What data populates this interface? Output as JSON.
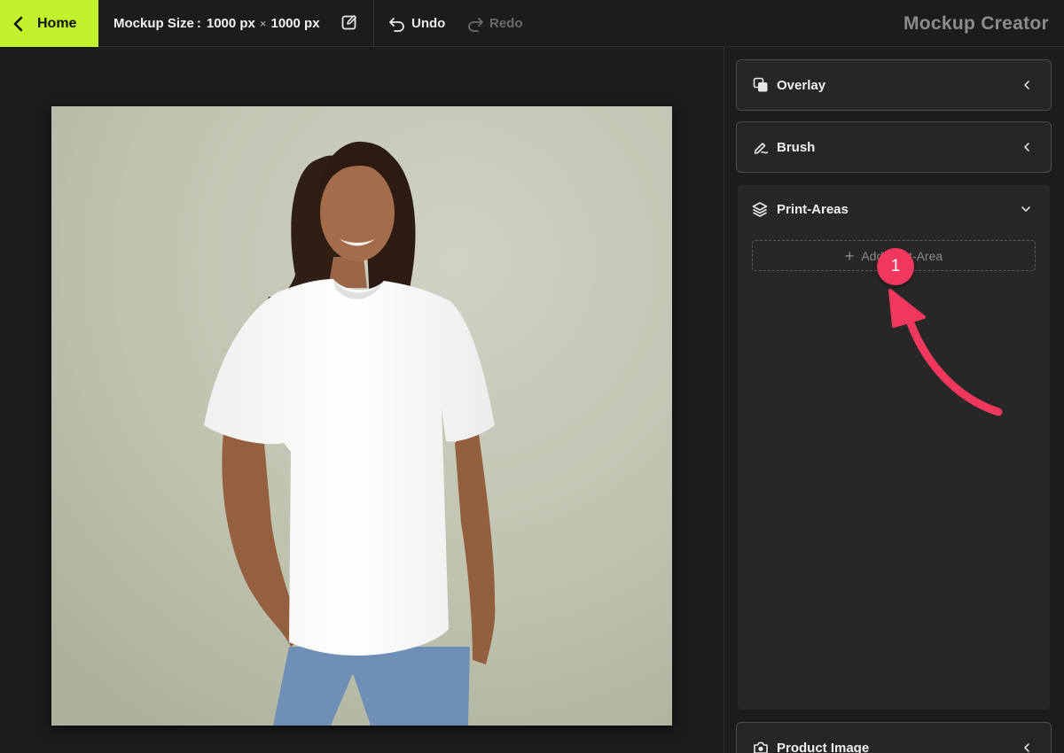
{
  "topbar": {
    "home_label": "Home",
    "mockup_size_label": "Mockup Size",
    "mockup_width": "1000 px",
    "times_sign": "×",
    "mockup_height": "1000 px",
    "undo_label": "Undo",
    "redo_label": "Redo",
    "app_title": "Mockup Creator"
  },
  "panel": {
    "sections": [
      {
        "label": "Overlay",
        "icon": "layers-copy-icon",
        "state": "collapsed"
      },
      {
        "label": "Brush",
        "icon": "brush-icon",
        "state": "collapsed"
      },
      {
        "label": "Print-Areas",
        "icon": "stack-icon",
        "state": "expanded"
      },
      {
        "label": "Product Image",
        "icon": "camera-icon",
        "state": "collapsed"
      }
    ],
    "add_print_area_label": "Add Print-Area"
  },
  "annotation": {
    "step_number": "1"
  },
  "colors": {
    "accent": "#c2f22c",
    "annotation": "#f0375c",
    "background": "#1c1c1c",
    "panel": "#272727"
  }
}
